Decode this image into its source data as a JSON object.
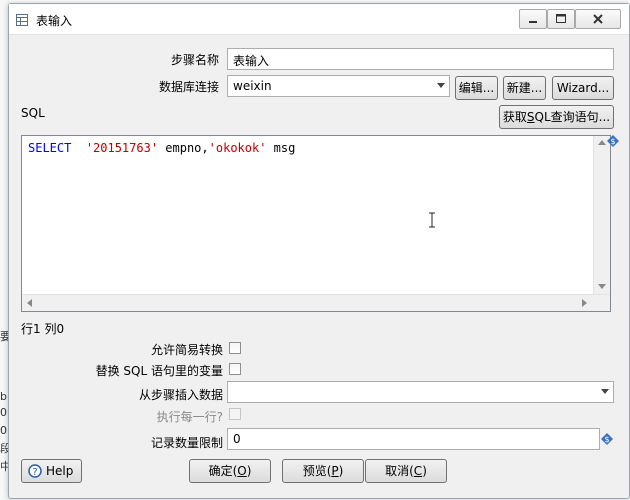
{
  "window": {
    "title": "表输入",
    "controls": [
      "minimize",
      "maximize",
      "close"
    ]
  },
  "form": {
    "step_name_label": "步骤名称",
    "step_name_value": "表输入",
    "db_conn_label": "数据库连接",
    "db_conn_value": "weixin",
    "edit_button": "编辑...",
    "new_button": "新建...",
    "wizard_button": "Wizard...",
    "sql_label": "SQL",
    "get_sql_button_prefix": "获取",
    "get_sql_button_mnemonic": "S",
    "get_sql_button_suffix": "QL查询语句...",
    "cursor_position": "行1 列0",
    "lazy_conversion_label": "允许简易转换",
    "replace_vars_label": "替换 SQL 语句里的变量",
    "insert_from_step_label": "从步骤插入数据",
    "insert_from_step_value": "",
    "execute_each_row_label": "执行每一行?",
    "limit_label": "记录数量限制",
    "limit_value": "0"
  },
  "sql": {
    "keyword": "SELECT",
    "literal1": "'20151763'",
    "mid": " empno,",
    "literal2": "'okokok'",
    "tail": " msg"
  },
  "footer": {
    "help_button": "Help",
    "ok_prefix": "确定(",
    "ok_mnemonic": "O",
    "ok_suffix": ")",
    "preview_prefix": "预览(",
    "preview_mnemonic": "P",
    "preview_suffix": ")",
    "cancel_prefix": "取消(",
    "cancel_mnemonic": "C",
    "cancel_suffix": ")"
  },
  "background_fragments": [
    "要",
    "b",
    "0",
    "0",
    "段",
    "中"
  ],
  "colors": {
    "sql_keyword": "#0000ff",
    "sql_string": "#c00000",
    "variable_icon": "#3b73c4"
  }
}
